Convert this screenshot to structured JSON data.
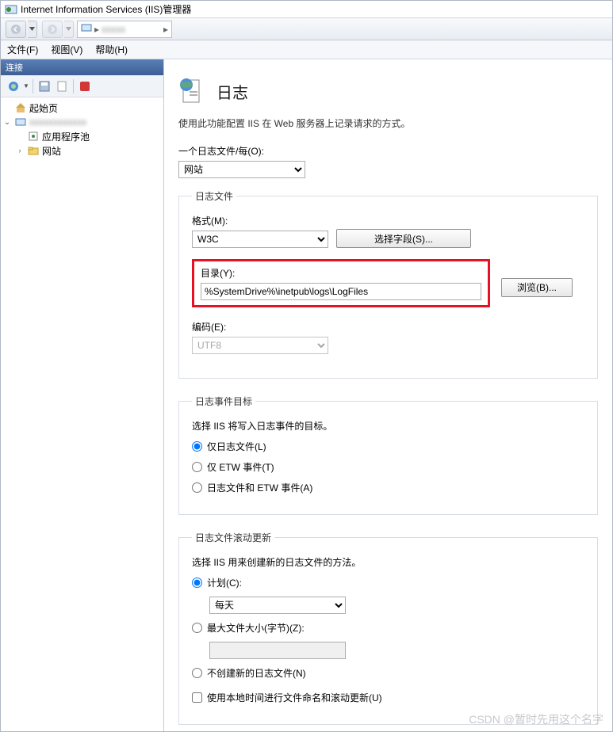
{
  "window": {
    "title": "Internet Information Services (IIS)管理器"
  },
  "menu": {
    "file": "文件(F)",
    "view": "视图(V)",
    "help": "帮助(H)"
  },
  "sidebar": {
    "header": "连接",
    "nodes": {
      "start": "起始页",
      "apppool": "应用程序池",
      "sites": "网站"
    }
  },
  "page": {
    "title": "日志",
    "desc": "使用此功能配置 IIS 在 Web 服务器上记录请求的方式。"
  },
  "filePer": {
    "label": "一个日志文件/每(O):",
    "value": "网站"
  },
  "logFile": {
    "legend": "日志文件",
    "format": {
      "label": "格式(M):",
      "value": "W3C",
      "btn": "选择字段(S)..."
    },
    "dir": {
      "label": "目录(Y):",
      "value": "%SystemDrive%\\inetpub\\logs\\LogFiles",
      "btn": "浏览(B)..."
    },
    "encoding": {
      "label": "编码(E):",
      "value": "UTF8"
    }
  },
  "eventTarget": {
    "legend": "日志事件目标",
    "desc": "选择 IIS 将写入日志事件的目标。",
    "opt1": "仅日志文件(L)",
    "opt2": "仅 ETW 事件(T)",
    "opt3": "日志文件和 ETW 事件(A)"
  },
  "rollover": {
    "legend": "日志文件滚动更新",
    "desc": "选择 IIS 用来创建新的日志文件的方法。",
    "schedule": {
      "label": "计划(C):",
      "value": "每天"
    },
    "maxsize": {
      "label": "最大文件大小(字节)(Z):"
    },
    "none": "不创建新的日志文件(N)",
    "localtime": "使用本地时间进行文件命名和滚动更新(U)"
  },
  "watermark": "CSDN @暂时先用这个名字"
}
